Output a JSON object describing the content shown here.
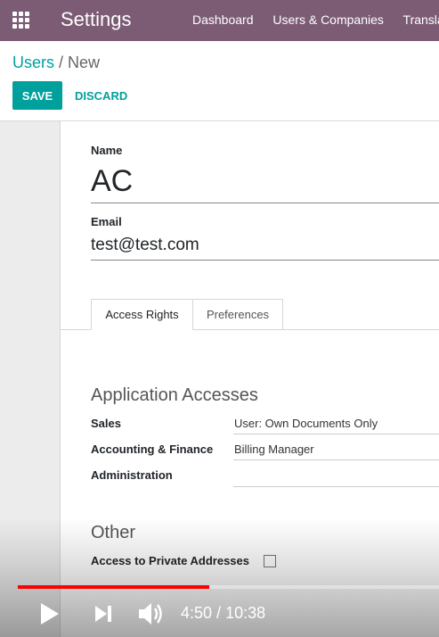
{
  "navbar": {
    "brand": "Settings",
    "menu": [
      "Dashboard",
      "Users & Companies",
      "Translations"
    ]
  },
  "breadcrumb": {
    "parent": "Users",
    "current": "New"
  },
  "buttons": {
    "save": "SAVE",
    "discard": "DISCARD"
  },
  "form": {
    "name_label": "Name",
    "name_value": "AC",
    "email_label": "Email",
    "email_value": "test@test.com"
  },
  "tabs": [
    "Access Rights",
    "Preferences"
  ],
  "sections": {
    "application_accesses": {
      "title": "Application Accesses",
      "rows": [
        {
          "label": "Sales",
          "value": "User: Own Documents Only"
        },
        {
          "label": "Accounting & Finance",
          "value": "Billing Manager"
        },
        {
          "label": "Administration",
          "value": ""
        }
      ]
    },
    "other": {
      "title": "Other",
      "rows": [
        {
          "label": "Access to Private Addresses",
          "checked": false
        }
      ]
    }
  },
  "video": {
    "current_time": "4:50",
    "separator": " / ",
    "duration": "10:38",
    "progress": 0.4545,
    "progress_color": "#ff0000"
  },
  "colors": {
    "navbar": "#7c5c75",
    "accent": "#00a09d"
  }
}
